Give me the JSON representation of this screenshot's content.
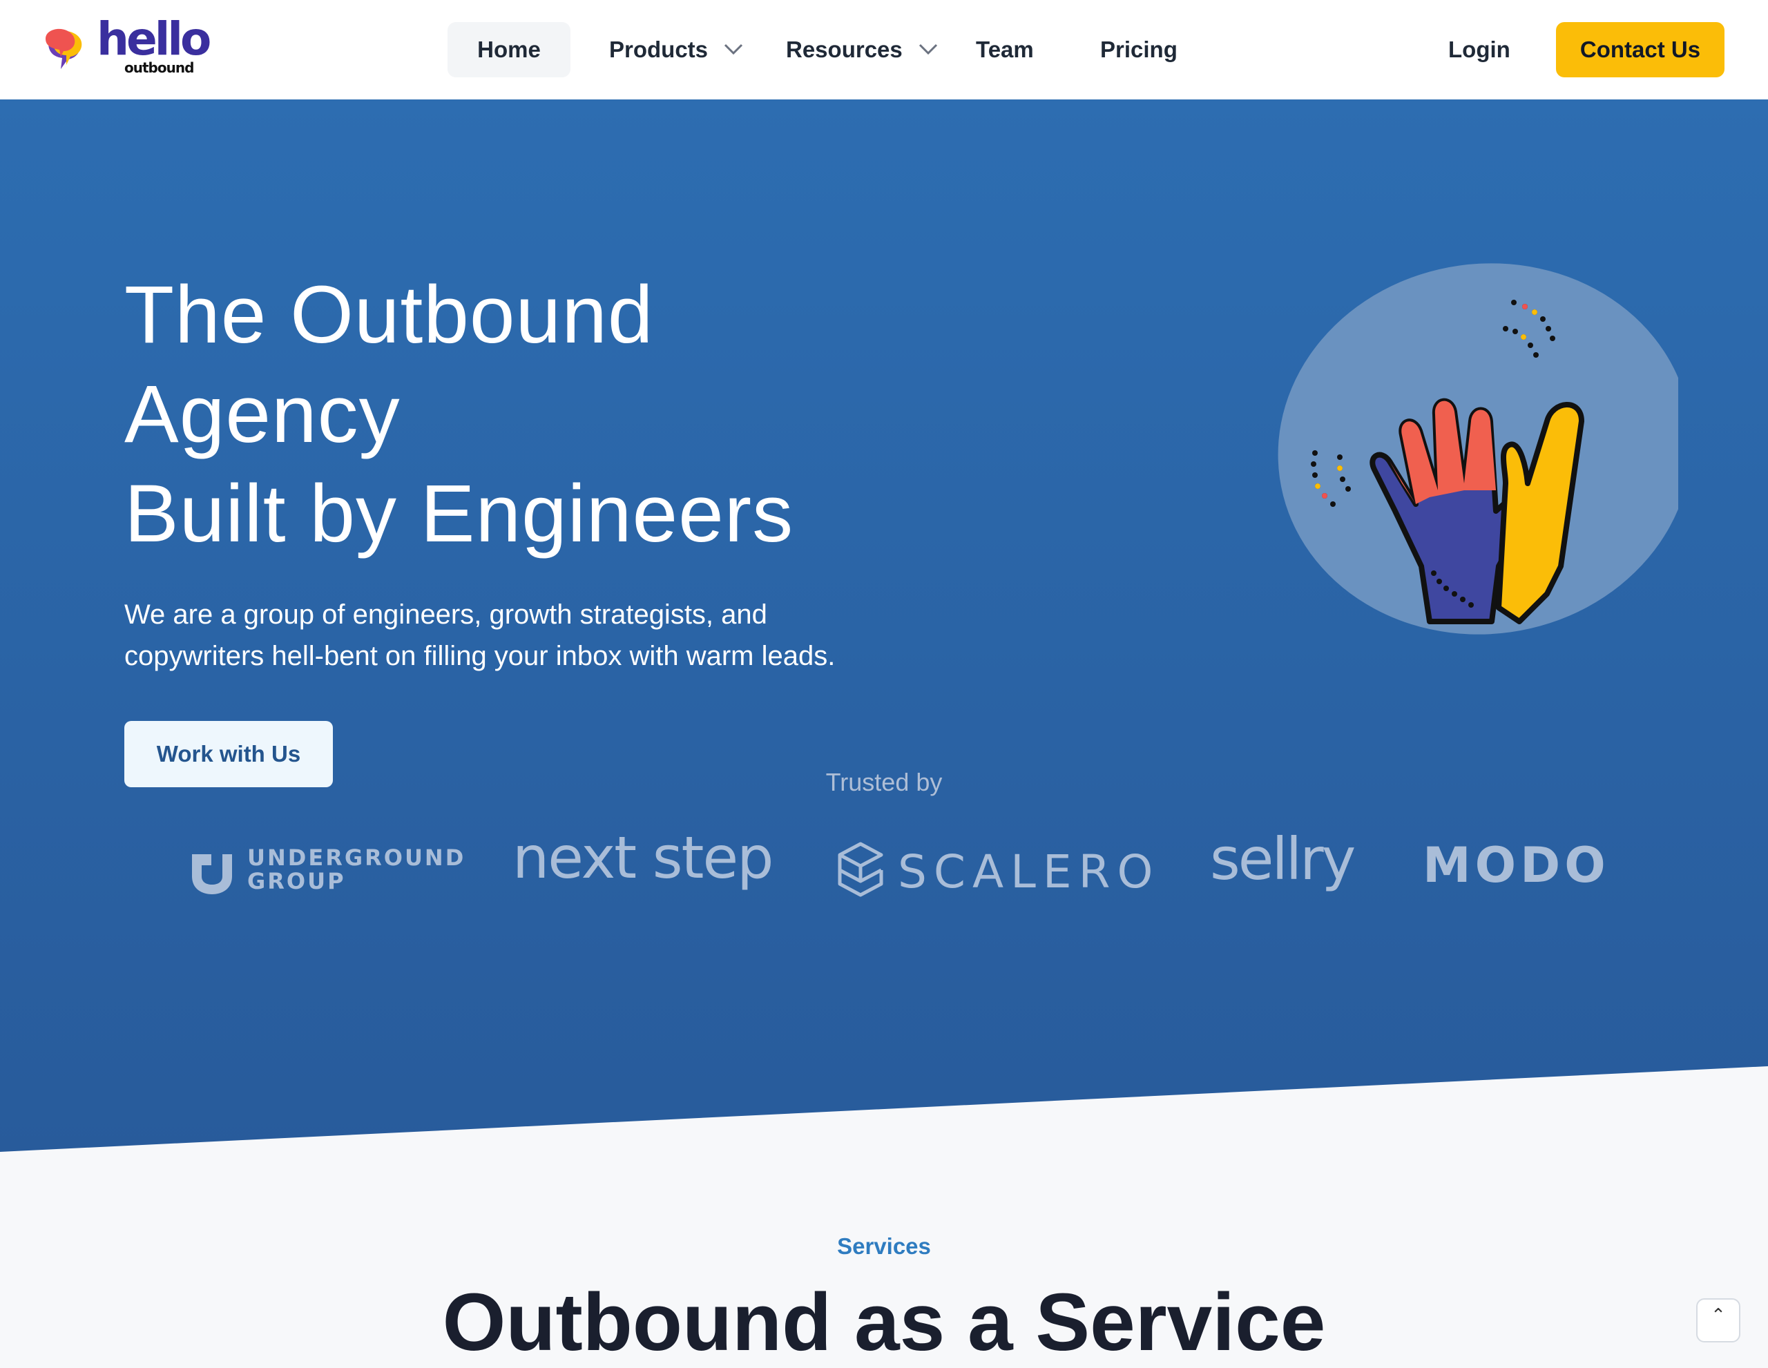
{
  "brand": {
    "name": "hello",
    "sub": "outbound",
    "colors": {
      "word": "#3a2f9e",
      "bubble_red": "#ef5350",
      "bubble_yellow": "#fbbd08",
      "bubble_purple": "#6a3fb5"
    }
  },
  "nav": {
    "items": [
      {
        "label": "Home",
        "active": true
      },
      {
        "label": "Products",
        "dropdown": true
      },
      {
        "label": "Resources",
        "dropdown": true
      },
      {
        "label": "Team"
      },
      {
        "label": "Pricing"
      }
    ],
    "login": "Login",
    "contact": "Contact Us"
  },
  "hero": {
    "title_lines": [
      "The Outbound",
      "Agency",
      "Built by Engineers"
    ],
    "subtitle_lines": [
      "We are a group of engineers, growth strategists, and",
      "copywriters hell-bent on filling your inbox with warm leads."
    ],
    "cta": "Work with Us",
    "illustration": "high-five-hands-icon"
  },
  "trusted": {
    "label": "Trusted by",
    "logos": [
      {
        "name": "UNDERGROUND GROUP",
        "lines": [
          "UNDERGROUND",
          "GROUP"
        ]
      },
      {
        "name": "next step"
      },
      {
        "name": "SCALERO"
      },
      {
        "name": "sellry"
      },
      {
        "name": "MODO"
      }
    ]
  },
  "services": {
    "label": "Services",
    "title": "Outbound as a Service"
  },
  "scroll_top": {
    "icon": "chevron-up-icon",
    "glyph": "⌃"
  },
  "colors": {
    "hero_top": "#2d6db1",
    "hero_bottom": "#285b9b",
    "accent_yellow": "#fbbd08",
    "services_blue": "#2f7cc0"
  }
}
